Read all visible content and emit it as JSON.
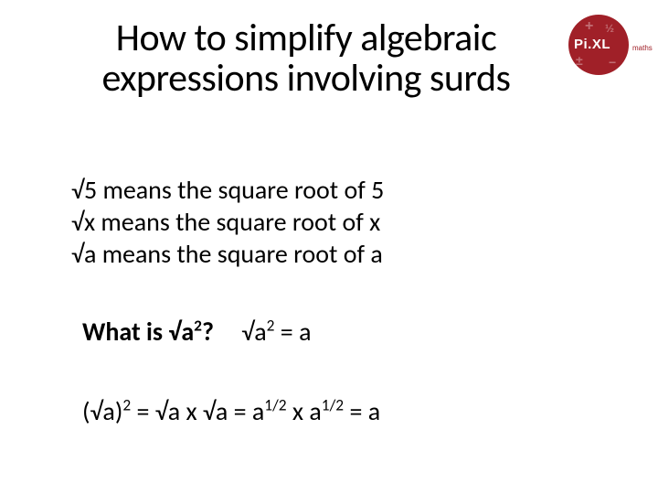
{
  "title": "How to simplify algebraic expressions involving surds",
  "logo": {
    "brand": "Pi.XL",
    "sub": "maths"
  },
  "definitions": {
    "line1": "√5 means the square root of 5",
    "line2": "√x means the square root of x",
    "line3": "√a means the square root of a"
  },
  "question": {
    "prefix": "What is √a",
    "exp": "2",
    "suffix": "?"
  },
  "answer": {
    "lhs_prefix": "√a",
    "lhs_exp": "2",
    "rhs": " = a"
  },
  "expansion": {
    "p1": "(√a)",
    "e1": "2",
    "p2": " = √a x √a = a",
    "e2": "1/2",
    "p3": " x a",
    "e3": "1/2",
    "p4": "  = a"
  }
}
